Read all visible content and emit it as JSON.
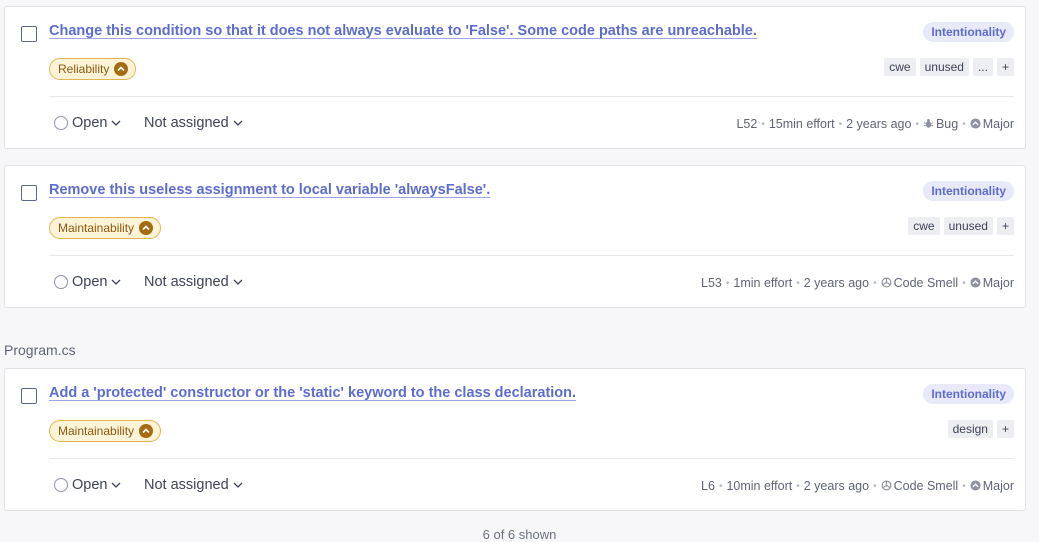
{
  "issues": [
    {
      "title": "Change this condition so that it does not always evaluate to 'False'. Some code paths are unreachable.",
      "attribute": "Intentionality",
      "quality": "Reliability",
      "tags": [
        "cwe",
        "unused",
        "...",
        "+"
      ],
      "status": "Open",
      "assignee": "Not assigned",
      "line": "L52",
      "effort": "15min effort",
      "age": "2 years ago",
      "type": "Bug",
      "type_icon": "bug-icon",
      "severity": "Major",
      "severity_icon": "major-severity-icon"
    },
    {
      "title": "Remove this useless assignment to local variable 'alwaysFalse'.",
      "attribute": "Intentionality",
      "quality": "Maintainability",
      "tags": [
        "cwe",
        "unused",
        "+"
      ],
      "status": "Open",
      "assignee": "Not assigned",
      "line": "L53",
      "effort": "1min effort",
      "age": "2 years ago",
      "type": "Code Smell",
      "type_icon": "code-smell-icon",
      "severity": "Major",
      "severity_icon": "major-severity-icon"
    },
    {
      "title": "Add a 'protected' constructor or the 'static' keyword to the class declaration.",
      "attribute": "Intentionality",
      "quality": "Maintainability",
      "tags": [
        "design",
        "+"
      ],
      "status": "Open",
      "assignee": "Not assigned",
      "line": "L6",
      "effort": "10min effort",
      "age": "2 years ago",
      "type": "Code Smell",
      "type_icon": "code-smell-icon",
      "severity": "Major",
      "severity_icon": "major-severity-icon"
    }
  ],
  "file_group": {
    "name": "Program.cs"
  },
  "footer": {
    "count_text": "6 of 6 shown"
  },
  "colors": {
    "link": "#5d6cd0",
    "badge_bg": "#e8eafa",
    "quality_bg": "#fdf3d6",
    "quality_border": "#e2b454",
    "quality_text": "#8a5a10",
    "severity_icon": "#8d93a3"
  }
}
